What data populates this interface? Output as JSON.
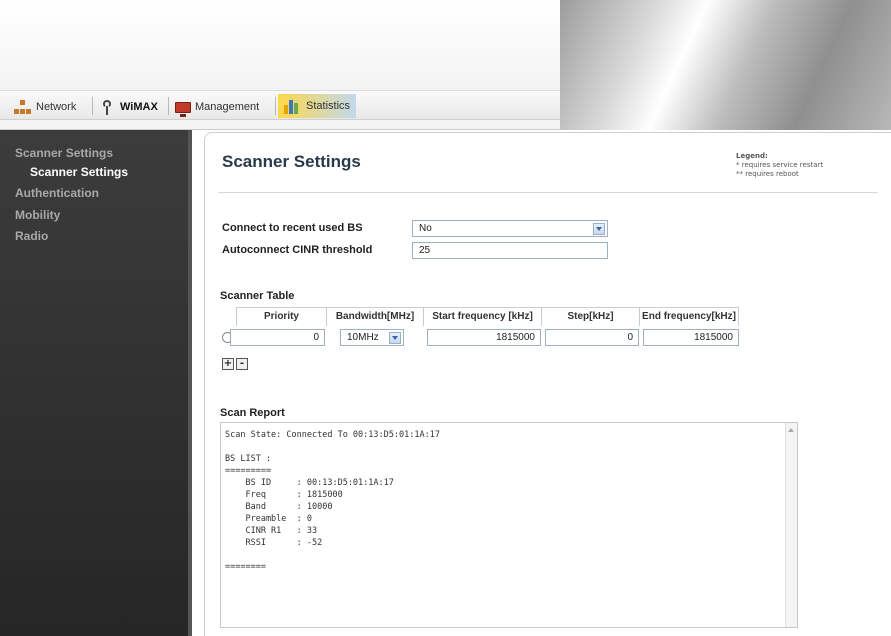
{
  "tabs": [
    {
      "label": "Network"
    },
    {
      "label": "WiMAX"
    },
    {
      "label": "Management"
    },
    {
      "label": "Statistics"
    }
  ],
  "sidebar": {
    "items": [
      {
        "label": "Scanner Settings"
      },
      {
        "label": "Scanner Settings"
      },
      {
        "label": "Authentication"
      },
      {
        "label": "Mobility"
      },
      {
        "label": "Radio"
      }
    ]
  },
  "page": {
    "title": "Scanner Settings"
  },
  "legend": {
    "title": "Legend:",
    "line1": "* requires service restart",
    "line2": "** requires reboot"
  },
  "form": {
    "connect_label": "Connect to recent used BS",
    "connect_value": "No",
    "cinr_label": "Autoconnect CINR threshold",
    "cinr_value": "25"
  },
  "scanner_table": {
    "title": "Scanner Table",
    "headers": [
      "Priority",
      "Bandwidth[MHz]",
      "Start frequency [kHz]",
      "Step[kHz]",
      "End frequency[kHz]"
    ],
    "row": {
      "priority": "0",
      "bandwidth": "10MHz",
      "start": "1815000",
      "step": "0",
      "end": "1815000"
    },
    "add_label": "+",
    "remove_label": "-"
  },
  "scan_report": {
    "title": "Scan Report",
    "text": "Scan State: Connected To 00:13:D5:01:1A:17\n\nBS LIST :\n=========\n    BS ID     : 00:13:D5:01:1A:17\n    Freq      : 1815000\n    Band      : 10000\n    Preamble  : 0\n    CINR R1   : 33\n    RSSI      : -52\n\n========"
  }
}
